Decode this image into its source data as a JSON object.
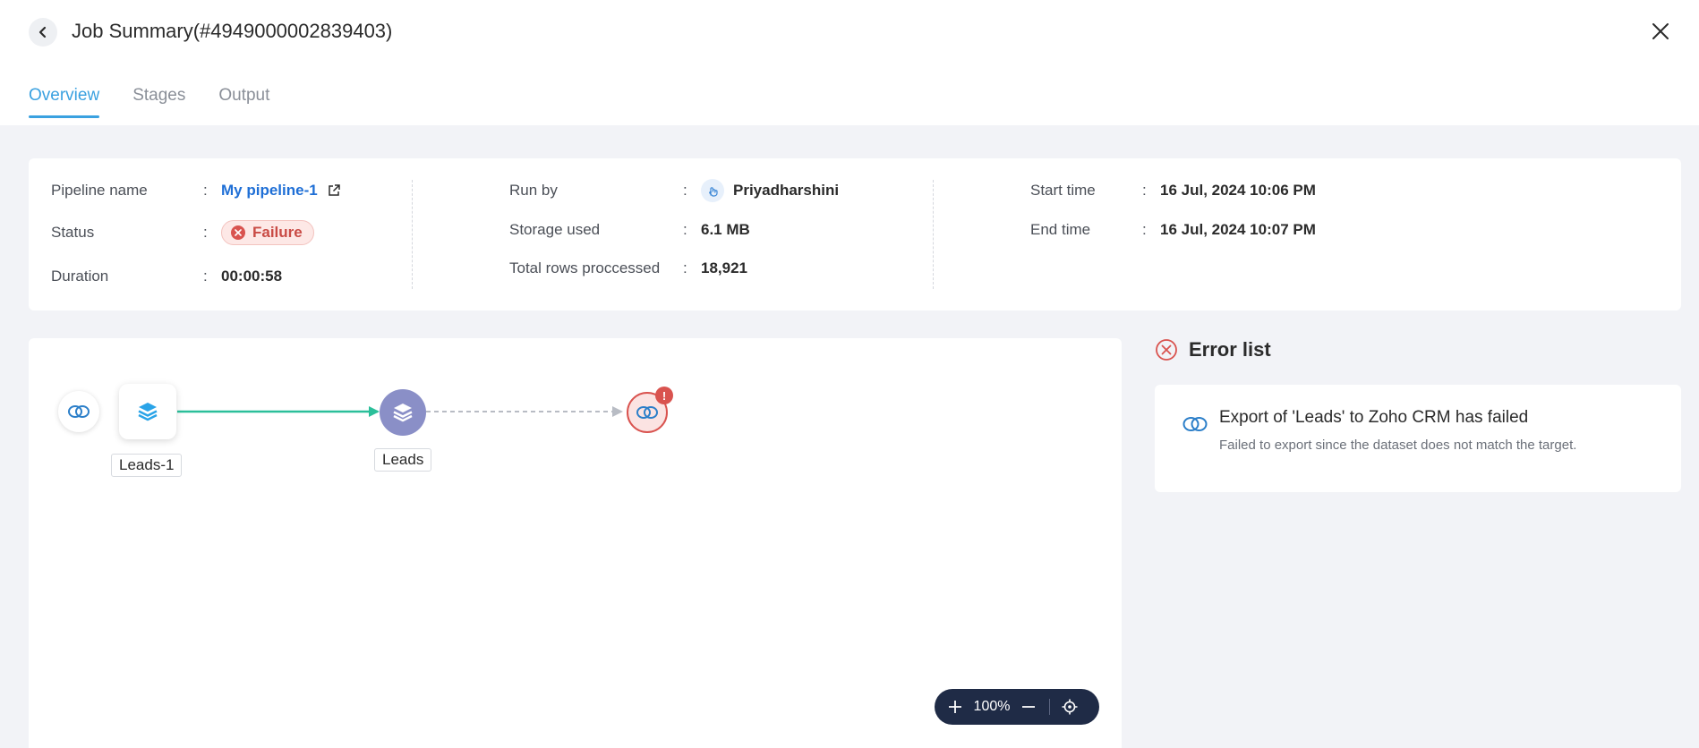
{
  "header": {
    "title": "Job Summary(#4949000002839403)",
    "back_icon": "chevron-left-icon",
    "close_icon": "close-icon"
  },
  "tabs": [
    {
      "label": "Overview",
      "active": true
    },
    {
      "label": "Stages",
      "active": false
    },
    {
      "label": "Output",
      "active": false
    }
  ],
  "summary": {
    "pipeline_name": {
      "label": "Pipeline name",
      "value": "My pipeline-1"
    },
    "status": {
      "label": "Status",
      "value": "Failure"
    },
    "duration": {
      "label": "Duration",
      "value": "00:00:58"
    },
    "run_by": {
      "label": "Run by",
      "value": "Priyadharshini"
    },
    "storage_used": {
      "label": "Storage used",
      "value": "6.1 MB"
    },
    "total_rows": {
      "label": "Total rows proccessed",
      "value": "18,921"
    },
    "start_time": {
      "label": "Start time",
      "value": "16 Jul, 2024 10:06 PM"
    },
    "end_time": {
      "label": "End time",
      "value": "16 Jul, 2024 10:07 PM"
    },
    "colon": ":"
  },
  "pipeline": {
    "nodes": [
      {
        "label": "Leads-1",
        "icon": "layers-icon"
      },
      {
        "label": "Leads",
        "icon": "layers-icon"
      }
    ],
    "error_badge": "!"
  },
  "zoom": {
    "level": "100%"
  },
  "errors": {
    "title": "Error list",
    "items": [
      {
        "title": "Export of 'Leads' to Zoho CRM has failed",
        "description": "Failed to export since the dataset does not match the target."
      }
    ]
  },
  "colors": {
    "accent": "#3aa1e0",
    "link": "#1f6fd6",
    "failure": "#d9534f",
    "success_line": "#2bbf9a",
    "node_purple": "#8a8fc7",
    "zoom_bg": "#1f2b46"
  }
}
